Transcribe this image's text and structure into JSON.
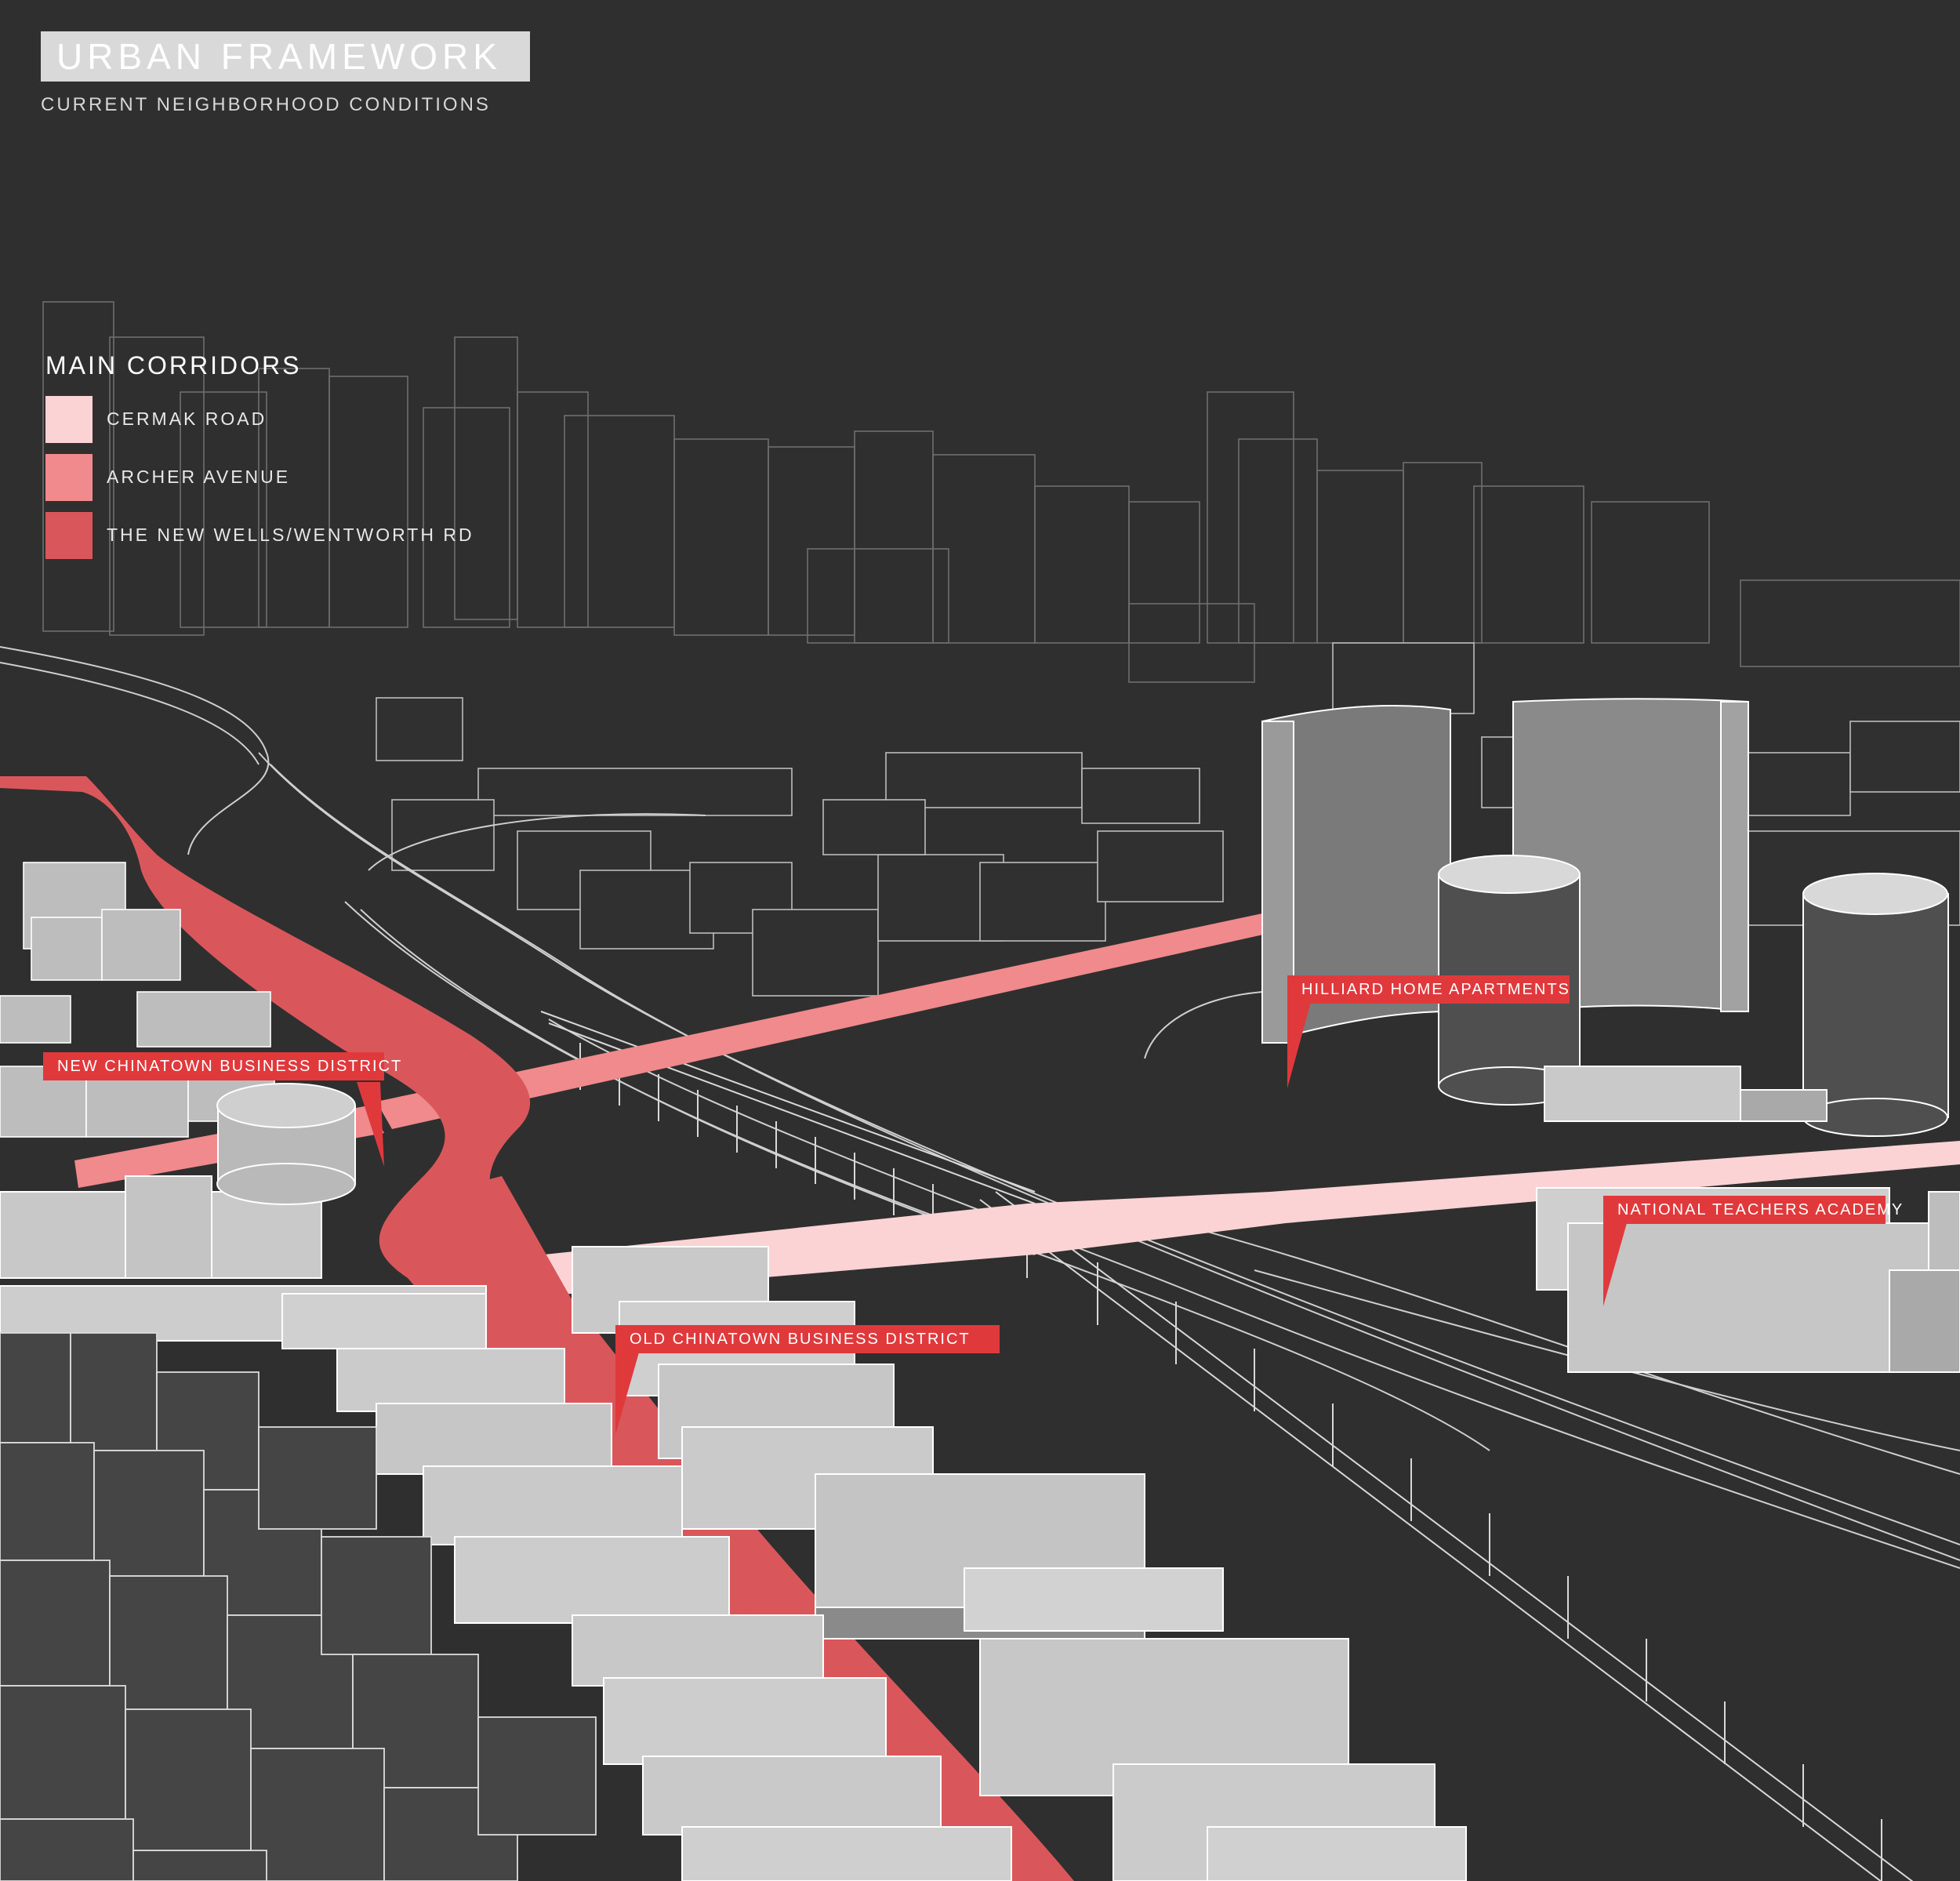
{
  "header": {
    "title": "URBAN FRAMEWORK",
    "subtitle": "CURRENT NEIGHBORHOOD CONDITIONS"
  },
  "legend": {
    "title": "MAIN CORRIDORS",
    "items": [
      {
        "label": "CERMAK ROAD",
        "color": "#fbd3d4"
      },
      {
        "label": "ARCHER AVENUE",
        "color": "#f08a8c"
      },
      {
        "label": "THE NEW WELLS/WENTWORTH RD",
        "color": "#d9575b"
      }
    ]
  },
  "callouts": {
    "new_chinatown": "NEW CHINATOWN BUSINESS DISTRICT",
    "hilliard": "HILLIARD HOME APARTMENTS",
    "national_teachers": "NATIONAL TEACHERS ACADEMY",
    "old_chinatown": "OLD CHINATOWN BUSINESS DISTRICT"
  },
  "colors": {
    "background": "#2f2f2f",
    "callout_red": "#e0393c",
    "building_light": "#c4c4c4",
    "building_mid": "#8a8a8a",
    "building_dark": "#555555",
    "skyline_line": "#7a7a7a"
  }
}
